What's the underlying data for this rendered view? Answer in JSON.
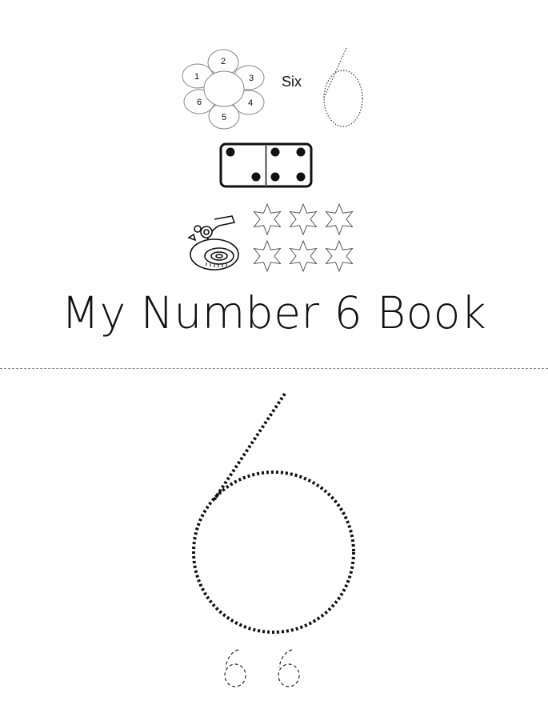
{
  "cover": {
    "flower_petal_numbers": [
      "1",
      "2",
      "3",
      "4",
      "5",
      "6"
    ],
    "number_word": "Six",
    "title": "My Number 6 Book"
  },
  "domino": {
    "left_pips": 2,
    "right_pips": 4
  },
  "stars": {
    "count": 6
  },
  "tracing": {
    "big_number": "6",
    "small_numbers": [
      "6",
      "6"
    ]
  }
}
